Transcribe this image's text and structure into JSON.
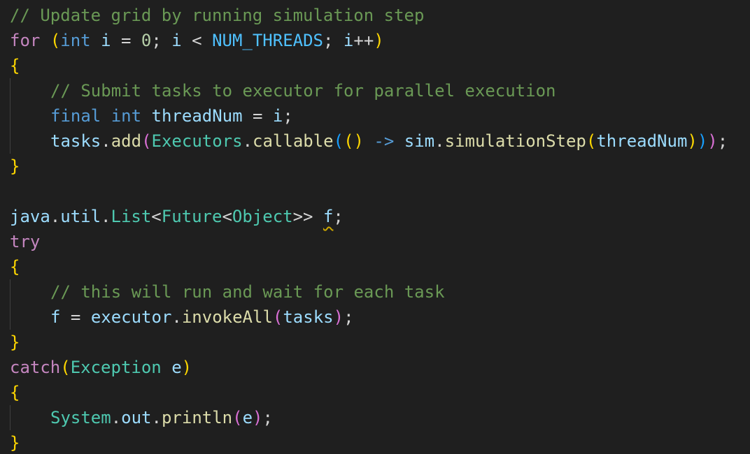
{
  "editor": {
    "colors": {
      "background": "#1f1f1f",
      "comment": "#6a9955",
      "keyword_control": "#c586c0",
      "keyword_type": "#569cd6",
      "variable": "#9cdcfe",
      "constant": "#4fc1ff",
      "number": "#b5cea8",
      "class": "#4ec9b0",
      "function": "#dcdcaa",
      "bracket1": "#ffd700",
      "bracket2": "#da70d6",
      "bracket3": "#179fff",
      "plain": "#d4d4d4",
      "warning": "#cca700"
    },
    "lines": [
      [
        {
          "t": "// Update grid by running simulation step",
          "c": "comment"
        }
      ],
      [
        {
          "t": "for",
          "c": "keyword_control"
        },
        {
          "t": " ",
          "c": "plain"
        },
        {
          "t": "(",
          "c": "bracket1"
        },
        {
          "t": "int",
          "c": "keyword_type"
        },
        {
          "t": " ",
          "c": "plain"
        },
        {
          "t": "i",
          "c": "variable"
        },
        {
          "t": " = ",
          "c": "plain"
        },
        {
          "t": "0",
          "c": "number"
        },
        {
          "t": "; ",
          "c": "plain"
        },
        {
          "t": "i",
          "c": "variable"
        },
        {
          "t": " < ",
          "c": "plain"
        },
        {
          "t": "NUM_THREADS",
          "c": "constant"
        },
        {
          "t": "; ",
          "c": "plain"
        },
        {
          "t": "i",
          "c": "variable"
        },
        {
          "t": "++",
          "c": "plain"
        },
        {
          "t": ")",
          "c": "bracket1"
        }
      ],
      [
        {
          "t": "{",
          "c": "bracket1"
        }
      ],
      [
        {
          "indent": true
        },
        {
          "t": "// Submit tasks to executor for parallel execution",
          "c": "comment"
        }
      ],
      [
        {
          "indent": true
        },
        {
          "t": "final",
          "c": "keyword_type"
        },
        {
          "t": " ",
          "c": "plain"
        },
        {
          "t": "int",
          "c": "keyword_type"
        },
        {
          "t": " ",
          "c": "plain"
        },
        {
          "t": "threadNum",
          "c": "variable"
        },
        {
          "t": " = ",
          "c": "plain"
        },
        {
          "t": "i",
          "c": "variable"
        },
        {
          "t": ";",
          "c": "plain"
        }
      ],
      [
        {
          "indent": true
        },
        {
          "t": "tasks",
          "c": "variable"
        },
        {
          "t": ".",
          "c": "plain"
        },
        {
          "t": "add",
          "c": "function"
        },
        {
          "t": "(",
          "c": "bracket2"
        },
        {
          "t": "Executors",
          "c": "class"
        },
        {
          "t": ".",
          "c": "plain"
        },
        {
          "t": "callable",
          "c": "function"
        },
        {
          "t": "(",
          "c": "bracket3"
        },
        {
          "t": "()",
          "c": "bracket1"
        },
        {
          "t": " ",
          "c": "plain"
        },
        {
          "t": "->",
          "c": "keyword_type"
        },
        {
          "t": " ",
          "c": "plain"
        },
        {
          "t": "sim",
          "c": "variable"
        },
        {
          "t": ".",
          "c": "plain"
        },
        {
          "t": "simulationStep",
          "c": "function"
        },
        {
          "t": "(",
          "c": "bracket1"
        },
        {
          "t": "threadNum",
          "c": "variable"
        },
        {
          "t": ")",
          "c": "bracket1"
        },
        {
          "t": ")",
          "c": "bracket3"
        },
        {
          "t": ")",
          "c": "bracket2"
        },
        {
          "t": ";",
          "c": "plain"
        }
      ],
      [
        {
          "t": "}",
          "c": "bracket1"
        }
      ],
      [],
      [
        {
          "t": "java",
          "c": "variable"
        },
        {
          "t": ".",
          "c": "plain"
        },
        {
          "t": "util",
          "c": "variable"
        },
        {
          "t": ".",
          "c": "plain"
        },
        {
          "t": "List",
          "c": "class"
        },
        {
          "t": "<",
          "c": "plain"
        },
        {
          "t": "Future",
          "c": "class"
        },
        {
          "t": "<",
          "c": "plain"
        },
        {
          "t": "Object",
          "c": "class"
        },
        {
          "t": ">> ",
          "c": "plain"
        },
        {
          "t": "f",
          "c": "variable",
          "warn": true
        },
        {
          "t": ";",
          "c": "plain"
        }
      ],
      [
        {
          "t": "try",
          "c": "keyword_control"
        }
      ],
      [
        {
          "t": "{",
          "c": "bracket1"
        }
      ],
      [
        {
          "indent": true
        },
        {
          "t": "// this will run and wait for each task",
          "c": "comment"
        }
      ],
      [
        {
          "indent": true
        },
        {
          "t": "f",
          "c": "variable"
        },
        {
          "t": " = ",
          "c": "plain"
        },
        {
          "t": "executor",
          "c": "variable"
        },
        {
          "t": ".",
          "c": "plain"
        },
        {
          "t": "invokeAll",
          "c": "function"
        },
        {
          "t": "(",
          "c": "bracket2"
        },
        {
          "t": "tasks",
          "c": "variable"
        },
        {
          "t": ")",
          "c": "bracket2"
        },
        {
          "t": ";",
          "c": "plain"
        }
      ],
      [
        {
          "t": "}",
          "c": "bracket1"
        }
      ],
      [
        {
          "t": "catch",
          "c": "keyword_control"
        },
        {
          "t": "(",
          "c": "bracket1"
        },
        {
          "t": "Exception",
          "c": "class"
        },
        {
          "t": " ",
          "c": "plain"
        },
        {
          "t": "e",
          "c": "variable"
        },
        {
          "t": ")",
          "c": "bracket1"
        }
      ],
      [
        {
          "t": "{",
          "c": "bracket1"
        }
      ],
      [
        {
          "indent": true
        },
        {
          "t": "System",
          "c": "class"
        },
        {
          "t": ".",
          "c": "plain"
        },
        {
          "t": "out",
          "c": "variable"
        },
        {
          "t": ".",
          "c": "plain"
        },
        {
          "t": "println",
          "c": "function"
        },
        {
          "t": "(",
          "c": "bracket2"
        },
        {
          "t": "e",
          "c": "variable"
        },
        {
          "t": ")",
          "c": "bracket2"
        },
        {
          "t": ";",
          "c": "plain"
        }
      ],
      [
        {
          "t": "}",
          "c": "bracket1"
        }
      ]
    ],
    "guides": [
      {
        "from_line": 3,
        "to_line": 5
      },
      {
        "from_line": 11,
        "to_line": 12
      },
      {
        "from_line": 16,
        "to_line": 16
      }
    ]
  }
}
